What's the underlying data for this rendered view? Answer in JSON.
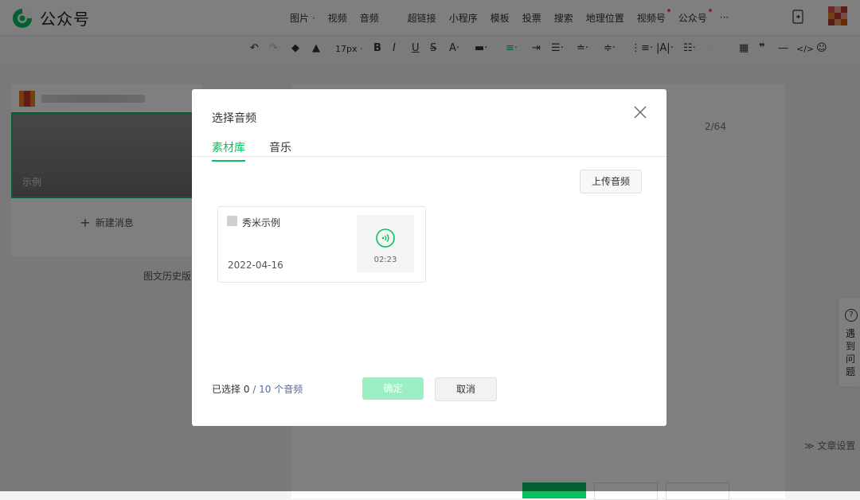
{
  "brand": {
    "name": "公众号"
  },
  "menu": [
    {
      "label": "图片 ·"
    },
    {
      "label": "视频"
    },
    {
      "label": "音频"
    },
    {
      "label": "超链接"
    },
    {
      "label": "小程序"
    },
    {
      "label": "模板"
    },
    {
      "label": "投票"
    },
    {
      "label": "搜索"
    },
    {
      "label": "地理位置"
    },
    {
      "label": "视频号"
    },
    {
      "label": "公众号"
    },
    {
      "label": "···"
    }
  ],
  "toolbar": {
    "font_size": "17px ·"
  },
  "left_panel": {
    "card_title": "示例",
    "new_message": "新建消息",
    "history": "图文历史版本"
  },
  "editor": {
    "count": "2/64"
  },
  "help": {
    "label": "遇到问题"
  },
  "article_settings": "≫ 文章设置",
  "dialog": {
    "title": "选择音频",
    "tabs": [
      {
        "label": "素材库"
      },
      {
        "label": "音乐"
      }
    ],
    "upload_button": "上传音频",
    "audio_items": [
      {
        "name": "秀米示例",
        "date": "2022-04-16",
        "duration": "02:23"
      }
    ],
    "selection": {
      "prefix": "已选择",
      "count": "0",
      "limit": "/ 10 个音频"
    },
    "confirm_button": "确定",
    "cancel_button": "取消"
  },
  "colors": {
    "accent": "#07c160",
    "link": "#576b95"
  }
}
